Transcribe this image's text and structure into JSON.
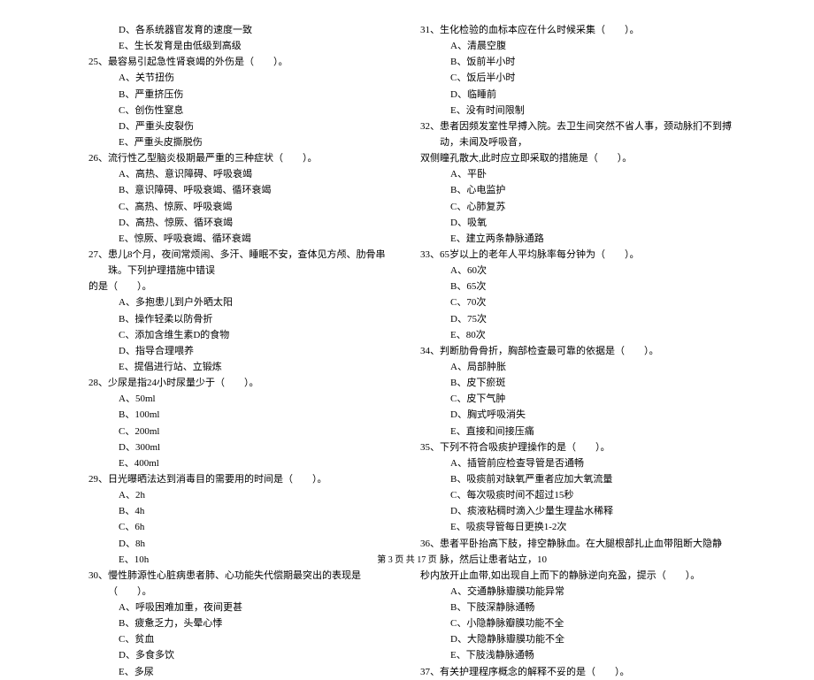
{
  "left": {
    "q24extra": [
      "D、各系统器官发育的速度一致",
      "E、生长发育是由低级到高级"
    ],
    "questions": [
      {
        "num": "25、",
        "text": "最容易引起急性肾衰竭的外伤是（　　）。",
        "options": [
          "A、关节扭伤",
          "B、严重挤压伤",
          "C、创伤性窒息",
          "D、严重头皮裂伤",
          "E、严重头皮撕脱伤"
        ]
      },
      {
        "num": "26、",
        "text": "流行性乙型脑炎极期最严重的三种症状（　　）。",
        "options": [
          "A、高热、意识障碍、呼吸衰竭",
          "B、意识障碍、呼吸衰竭、循环衰竭",
          "C、高热、惊厥、呼吸衰竭",
          "D、高热、惊厥、循环衰竭",
          "E、惊厥、呼吸衰竭、循环衰竭"
        ]
      },
      {
        "num": "27、",
        "text": "患儿8个月，夜间常烦闹、多汗、睡眠不安，查体见方颅、肋骨串珠。下列护理措施中错误",
        "text2": "的是（　　）。",
        "options": [
          "A、多抱患儿到户外晒太阳",
          "B、操作轻柔以防骨折",
          "C、添加含维生素D的食物",
          "D、指导合理喂养",
          "E、提倡进行站、立锻炼"
        ]
      },
      {
        "num": "28、",
        "text": "少尿是指24小时尿量少于（　　）。",
        "options": [
          "A、50ml",
          "B、100ml",
          "C、200ml",
          "D、300ml",
          "E、400ml"
        ]
      },
      {
        "num": "29、",
        "text": "日光曝晒法达到消毒目的需要用的时间是（　　）。",
        "options": [
          "A、2h",
          "B、4h",
          "C、6h",
          "D、8h",
          "E、10h"
        ]
      },
      {
        "num": "30、",
        "text": "慢性肺源性心脏病患者肺、心功能失代偿期最突出的表现是（　　）。",
        "options": [
          "A、呼吸困难加重，夜间更甚",
          "B、疲惫乏力，头晕心悸",
          "C、贫血",
          "D、多食多饮",
          "E、多尿"
        ]
      }
    ]
  },
  "right": {
    "questions": [
      {
        "num": "31、",
        "text": "生化检验的血标本应在什么时候采集（　　）。",
        "options": [
          "A、清晨空腹",
          "B、饭前半小时",
          "C、饭后半小时",
          "D、临睡前",
          "E、没有时间限制"
        ]
      },
      {
        "num": "32、",
        "text": "患者因频发室性早搏入院。去卫生间突然不省人事，颈动脉扪不到搏动，未闻及呼吸音，",
        "text2": "双侧瞳孔散大,此时应立即采取的措施是（　　）。",
        "options": [
          "A、平卧",
          "B、心电监护",
          "C、心肺复苏",
          "D、吸氧",
          "E、建立两条静脉通路"
        ]
      },
      {
        "num": "33、",
        "text": "65岁以上的老年人平均脉率每分钟为（　　）。",
        "options": [
          "A、60次",
          "B、65次",
          "C、70次",
          "D、75次",
          "E、80次"
        ]
      },
      {
        "num": "34、",
        "text": "判断肋骨骨折，胸部检查最可靠的依据是（　　）。",
        "options": [
          "A、局部肿胀",
          "B、皮下瘀斑",
          "C、皮下气肿",
          "D、胸式呼吸消失",
          "E、直接和间接压痛"
        ]
      },
      {
        "num": "35、",
        "text": "下列不符合吸痰护理操作的是（　　）。",
        "options": [
          "A、插管前应检查导管是否通畅",
          "B、吸痰前对缺氧严重者应加大氧流量",
          "C、每次吸痰时间不超过15秒",
          "D、痰液粘稠时滴入少量生理盐水稀释",
          "E、吸痰导管每日更换1-2次"
        ]
      },
      {
        "num": "36、",
        "text": "患者平卧抬高下肢，排空静脉血。在大腿根部扎止血带阻断大隐静脉，然后让患者站立，10",
        "text2": "秒内放开止血带,如出现自上而下的静脉逆向充盈，提示（　　）。",
        "options": [
          "A、交通静脉瓣膜功能异常",
          "B、下肢深静脉通畅",
          "C、小隐静脉瓣膜功能不全",
          "D、大隐静脉瓣膜功能不全",
          "E、下肢浅静脉通畅"
        ]
      },
      {
        "num": "37、",
        "text": "有关护理程序概念的解释不妥的是（　　）。"
      }
    ]
  },
  "footer": "第 3 页 共 17 页"
}
